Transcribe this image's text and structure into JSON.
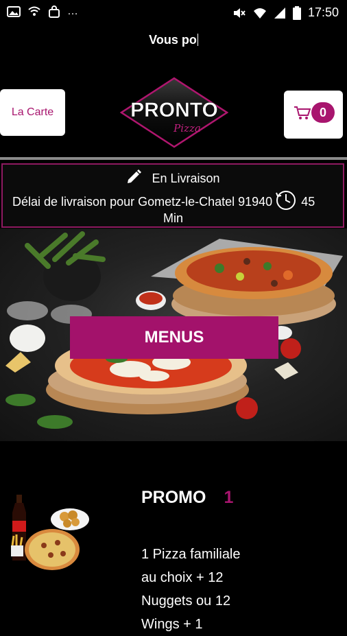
{
  "status_bar": {
    "left_icons": [
      "gallery-icon",
      "wifi-settings-icon",
      "bag-icon",
      "more-dots-icon"
    ],
    "right_icons": [
      "mute-icon",
      "wifi-icon",
      "signal-icon",
      "battery-icon"
    ],
    "time": "17:50"
  },
  "top_text": "Vous po",
  "header": {
    "carte_label": "La Carte",
    "logo_text": "PRONTO",
    "logo_sub": "Pizza",
    "cart_count": "0"
  },
  "delivery": {
    "mode": "En Livraison",
    "line": "Délai de livraison pour Gometz-le-Chatel 91940",
    "minutes": "45",
    "unit": "Min"
  },
  "hero": {
    "button_label": "MENUS"
  },
  "promo": {
    "title": "PROMO",
    "number": "1",
    "description": "1 Pizza familiale\nau choix + 12\nNuggets ou 12\nWings + 1"
  },
  "colors": {
    "brand": "#a8156e",
    "background": "#000000",
    "divider": "#8a8a8a"
  }
}
